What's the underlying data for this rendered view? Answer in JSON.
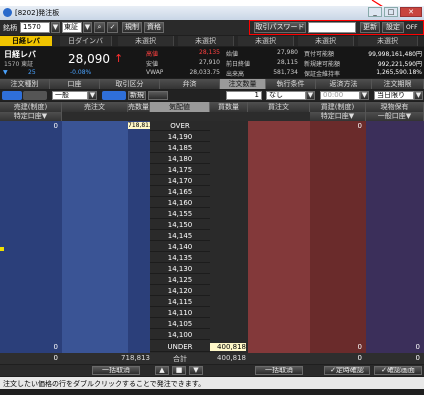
{
  "window": {
    "title": "[8202]発注板"
  },
  "toolbar": {
    "code_label": "銘柄",
    "code_value": "1570",
    "market_value": "東証",
    "btn1": "規制",
    "btn2": "資格",
    "password_label": "取引パスワード",
    "password_value": "",
    "update_label": "更新",
    "settings_label": "設定",
    "off_label": "OFF"
  },
  "tabs": [
    "日経レバ",
    "日ダインバ",
    "未選択",
    "未選択",
    "未選択",
    "未選択",
    "未選択"
  ],
  "quote": {
    "name": "日経レバ",
    "sub": "1570 東証",
    "price": "28,090",
    "arrow": "↑",
    "change": "25",
    "change_pct": "-0.08%",
    "labels": [
      "高値",
      "安値",
      "VWAP"
    ],
    "values": [
      "28,135",
      "27,910",
      "28,033.75"
    ],
    "labels2": [
      "始値",
      "前日終値",
      "出来高"
    ],
    "values2": [
      "27,980",
      "28,115",
      "581,734"
    ],
    "labels3": [
      "買付可能額",
      "新規建可能額",
      "保証金維持率"
    ],
    "values3": [
      "99,998,161,480円",
      "992,221,590円",
      "1,265,590.18%"
    ]
  },
  "order": {
    "headers": [
      "注文種別",
      "口座",
      "取引区分",
      "弁済",
      "注文数量",
      "執行条件",
      "返済方法",
      "注文期限"
    ],
    "type_value": "一般",
    "new_label": "新規",
    "qty_value": "1",
    "unit_value": "なし",
    "cond_value": "なし",
    "time_value": "00:00",
    "expiry_value": "当日限り"
  },
  "board": {
    "col_headers": [
      "売建(制度)",
      "売注文",
      "売数量",
      "気配値",
      "買数量",
      "買注文",
      "買建(制度)",
      "現物保有"
    ],
    "sub_headers": [
      "特定口座▼",
      "特定口座▼",
      "一般口座▼"
    ],
    "top_zero": "0",
    "sell_qty_top": "718,813",
    "over_label": "OVER",
    "under_label": "UNDER",
    "prices": [
      "14,190",
      "14,185",
      "14,180",
      "14,175",
      "14,170",
      "14,165",
      "14,160",
      "14,155",
      "14,150",
      "14,145",
      "14,140",
      "14,135",
      "14,130",
      "14,125",
      "14,120",
      "14,115",
      "14,110",
      "14,105",
      "14,100",
      "14,095"
    ],
    "buy_qty_bottom": "400,818",
    "footer_zero": "0",
    "total_label": "合計",
    "total_sell": "718,813",
    "total_buy": "400,818"
  },
  "bottom": {
    "cancel_all_sell": "一括取消",
    "cancel_all_buy": "一括取消",
    "check1": "定時確認",
    "check2": "確認画面",
    "status": "注文したい価格の行をダブルクリックすることで発注できます。"
  },
  "colors": {
    "accent": "#f0c400",
    "price_up": "#ff3030",
    "sell": "#2b3f7a",
    "buy": "#6a2b2b",
    "highlight": "#ff0000"
  }
}
